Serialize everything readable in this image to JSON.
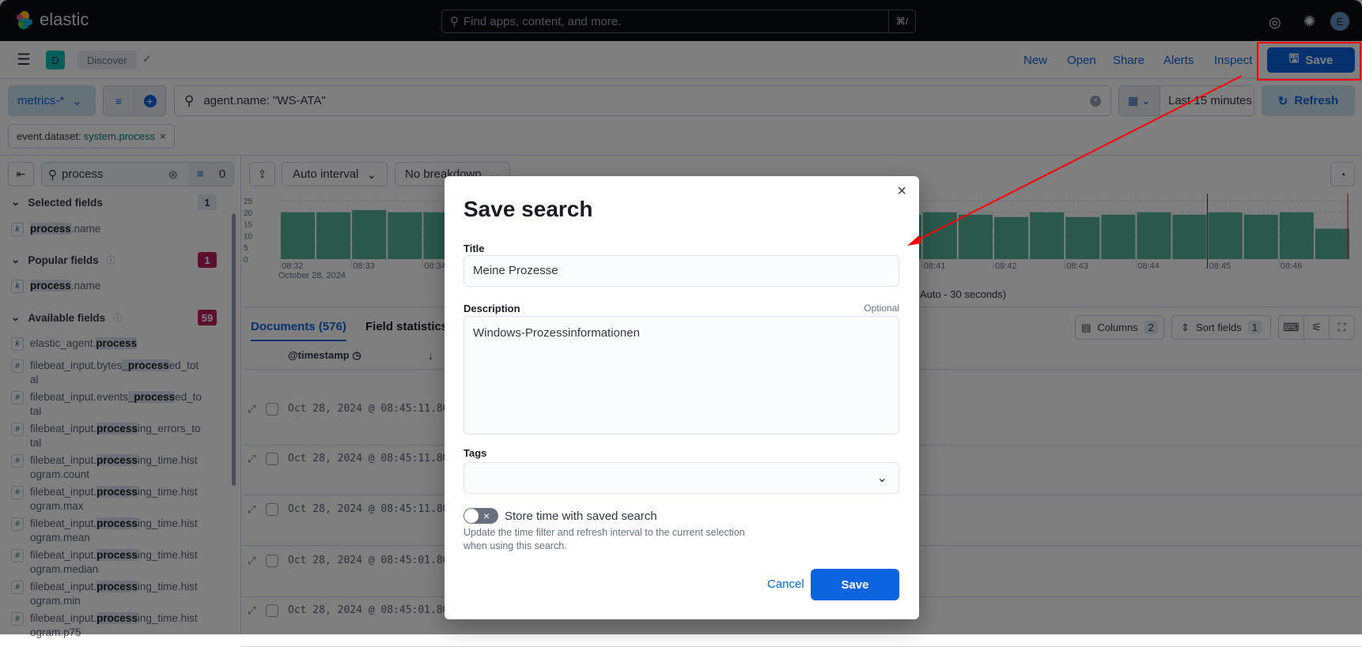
{
  "app": {
    "brand": "elastic",
    "global_search_placeholder": "Find apps, content, and more.",
    "global_search_shortcut": "⌘/",
    "avatar_initial": "E"
  },
  "header": {
    "space_initial": "D",
    "breadcrumb": "Discover",
    "links": [
      "New",
      "Open",
      "Share",
      "Alerts",
      "Inspect"
    ],
    "save_label": "Save"
  },
  "query": {
    "data_view": "metrics-*",
    "query": "agent.name: \"WS-ATA\"",
    "time_range": "Last 15 minutes",
    "refresh_label": "Refresh",
    "filter_key": "event.dataset: ",
    "filter_value": "system.process"
  },
  "sidebar": {
    "search_value": "process",
    "filter_count": "0",
    "selected": {
      "label": "Selected fields",
      "count": "1",
      "fields": [
        {
          "type": "k",
          "pre": "",
          "hl": "process",
          "post": ".name"
        }
      ]
    },
    "popular": {
      "label": "Popular fields",
      "count": "1",
      "fields": [
        {
          "type": "k",
          "pre": "",
          "hl": "process",
          "post": ".name"
        }
      ]
    },
    "available": {
      "label": "Available fields",
      "count": "59",
      "fields": [
        {
          "type": "k",
          "pre": "elastic_agent.",
          "hl": "process",
          "post": "",
          "l2": ""
        },
        {
          "type": "#",
          "pre": "filebeat_input.bytes",
          "hl": "_process",
          "post": "ed_tot",
          "l2": "al"
        },
        {
          "type": "#",
          "pre": "filebeat_input.events",
          "hl": "_process",
          "post": "ed_to",
          "l2": "tal"
        },
        {
          "type": "#",
          "pre": "filebeat_input.",
          "hl": "process",
          "post": "ing_errors_to",
          "l2": "tal"
        },
        {
          "type": "#",
          "pre": "filebeat_input.",
          "hl": "process",
          "post": "ing_time.hist",
          "l2": "ogram.count"
        },
        {
          "type": "#",
          "pre": "filebeat_input.",
          "hl": "process",
          "post": "ing_time.hist",
          "l2": "ogram.max"
        },
        {
          "type": "#",
          "pre": "filebeat_input.",
          "hl": "process",
          "post": "ing_time.hist",
          "l2": "ogram.mean"
        },
        {
          "type": "#",
          "pre": "filebeat_input.",
          "hl": "process",
          "post": "ing_time.hist",
          "l2": "ogram.median"
        },
        {
          "type": "#",
          "pre": "filebeat_input.",
          "hl": "process",
          "post": "ing_time.hist",
          "l2": "ogram.min"
        },
        {
          "type": "#",
          "pre": "filebeat_input.",
          "hl": "process",
          "post": "ing_time.hist",
          "l2": "ogram.p75"
        }
      ]
    }
  },
  "histogram_controls": {
    "interval": "Auto interval",
    "breakdown": "No breakdown",
    "interval_note": "Auto - 30 seconds)"
  },
  "chart_data": {
    "type": "bar",
    "ylim": [
      0,
      25
    ],
    "yticks": [
      "25",
      "20",
      "15",
      "10",
      "5",
      "0"
    ],
    "xticks": [
      "08:32",
      "08:33",
      "08:34",
      "08:41",
      "08:42",
      "08:43",
      "08:44",
      "08:45",
      "08:46"
    ],
    "date_label": "October 28, 2024",
    "values": [
      20,
      20,
      21,
      20,
      20,
      null,
      null,
      null,
      null,
      null,
      null,
      null,
      null,
      null,
      null,
      null,
      null,
      19,
      20,
      19,
      18,
      20,
      18,
      19,
      20,
      19,
      20,
      19,
      20,
      13
    ],
    "bar_color": "#54b399"
  },
  "table": {
    "tabs": [
      "Documents (576)",
      "Field statistics"
    ],
    "columns_label": "Columns",
    "columns_count": "2",
    "sort_label": "Sort fields",
    "sort_count": "1",
    "header_timestamp": "@timestamp",
    "rows": [
      "Oct 28, 2024 @ 08:45:11.804",
      "Oct 28, 2024 @ 08:45:11.804",
      "Oct 28, 2024 @ 08:45:11.804",
      "Oct 28, 2024 @ 08:45:01.804",
      "Oct 28, 2024 @ 08:45:01.804"
    ]
  },
  "modal": {
    "title": "Save search",
    "title_label": "Title",
    "title_value": "Meine Prozesse",
    "desc_label": "Description",
    "desc_optional": "Optional",
    "desc_value": "Windows-Prozessinformationen",
    "tags_label": "Tags",
    "toggle_label": "Store time with saved search",
    "toggle_on": false,
    "help1": "Update the time filter and refresh interval to the current selection",
    "help2": "when using this search.",
    "cancel": "Cancel",
    "save": "Save"
  },
  "colors": {
    "primary": "#0b64dd",
    "annotation": "#ff0000",
    "accent_badge": "#b91e5f"
  }
}
